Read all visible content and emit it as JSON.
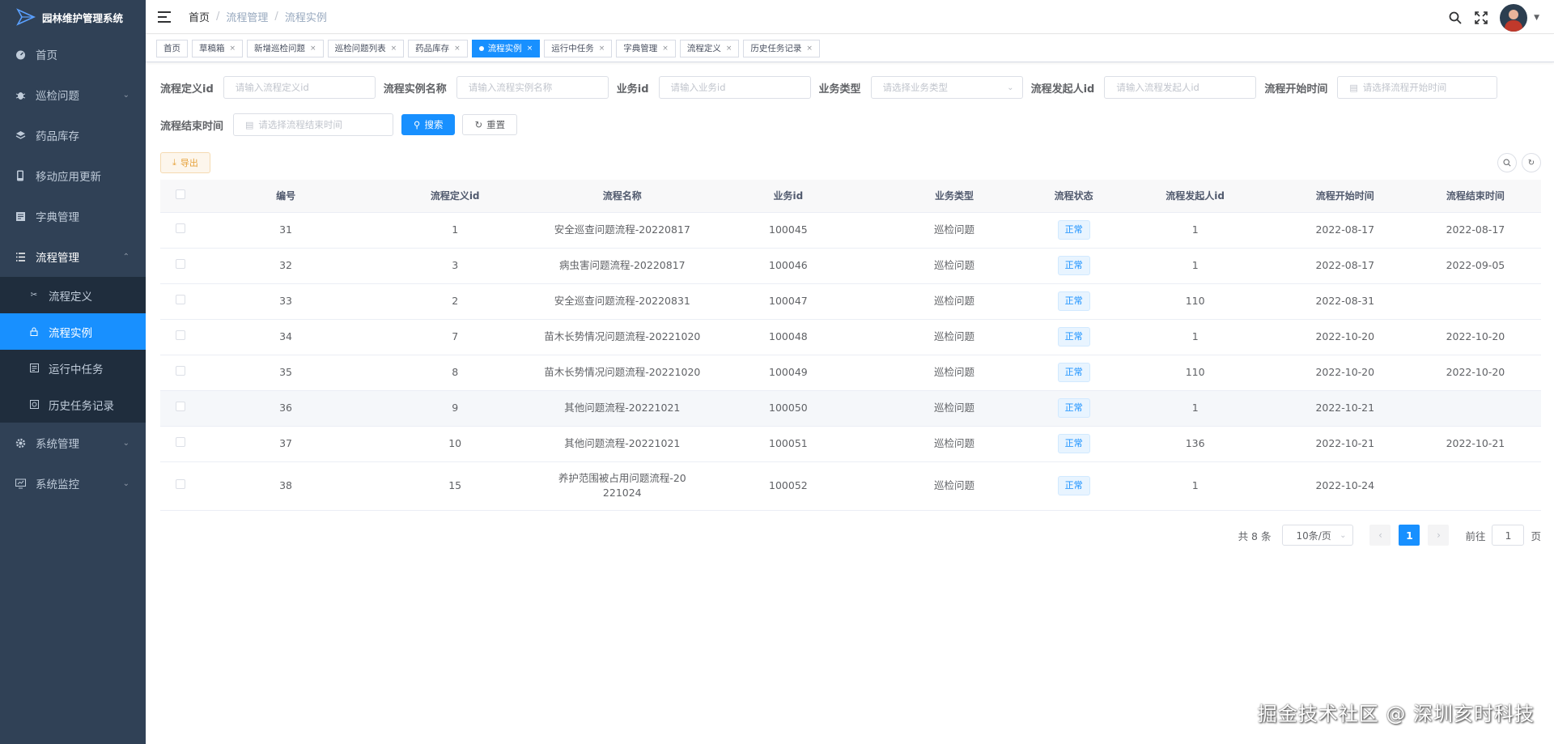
{
  "app": {
    "title": "园林维护管理系统"
  },
  "sidebar": {
    "items": [
      {
        "label": "首页",
        "icon": "dashboard-icon"
      },
      {
        "label": "巡检问题",
        "icon": "bug-icon",
        "has_children": true
      },
      {
        "label": "药品库存",
        "icon": "layers-icon"
      },
      {
        "label": "移动应用更新",
        "icon": "phone-icon"
      },
      {
        "label": "字典管理",
        "icon": "dict-icon"
      },
      {
        "label": "流程管理",
        "icon": "list-icon",
        "expanded": true
      },
      {
        "label": "系统管理",
        "icon": "gear-icon",
        "has_children": true
      },
      {
        "label": "系统监控",
        "icon": "monitor-icon",
        "has_children": true
      }
    ],
    "sub_items": [
      {
        "label": "流程定义",
        "icon": "tool-icon"
      },
      {
        "label": "流程实例",
        "icon": "lock-icon",
        "active": true
      },
      {
        "label": "运行中任务",
        "icon": "doc-icon"
      },
      {
        "label": "历史任务记录",
        "icon": "history-icon"
      }
    ]
  },
  "breadcrumb": [
    "首页",
    "流程管理",
    "流程实例"
  ],
  "tags": [
    {
      "label": "首页",
      "closable": false
    },
    {
      "label": "草稿箱",
      "closable": true
    },
    {
      "label": "新增巡检问题",
      "closable": true
    },
    {
      "label": "巡检问题列表",
      "closable": true
    },
    {
      "label": "药品库存",
      "closable": true
    },
    {
      "label": "流程实例",
      "closable": true,
      "active": true
    },
    {
      "label": "运行中任务",
      "closable": true
    },
    {
      "label": "字典管理",
      "closable": true
    },
    {
      "label": "流程定义",
      "closable": true
    },
    {
      "label": "历史任务记录",
      "closable": true
    }
  ],
  "search": {
    "def_id_label": "流程定义id",
    "def_id_placeholder": "请输入流程定义id",
    "inst_name_label": "流程实例名称",
    "inst_name_placeholder": "请输入流程实例名称",
    "biz_id_label": "业务id",
    "biz_id_placeholder": "请输入业务id",
    "biz_type_label": "业务类型",
    "biz_type_placeholder": "请选择业务类型",
    "initiator_label": "流程发起人id",
    "initiator_placeholder": "请输入流程发起人id",
    "start_label": "流程开始时间",
    "start_placeholder": "请选择流程开始时间",
    "end_label": "流程结束时间",
    "end_placeholder": "请选择流程结束时间",
    "search_btn": "搜索",
    "reset_btn": "重置"
  },
  "toolbar": {
    "export_label": "导出"
  },
  "table": {
    "columns": [
      "编号",
      "流程定义id",
      "流程名称",
      "业务id",
      "业务类型",
      "流程状态",
      "流程发起人id",
      "流程开始时间",
      "流程结束时间"
    ],
    "rows": [
      [
        "31",
        "1",
        "安全巡查问题流程-20220817",
        "100045",
        "巡检问题",
        "正常",
        "1",
        "2022-08-17",
        "2022-08-17"
      ],
      [
        "32",
        "3",
        "病虫害问题流程-20220817",
        "100046",
        "巡检问题",
        "正常",
        "1",
        "2022-08-17",
        "2022-09-05"
      ],
      [
        "33",
        "2",
        "安全巡查问题流程-20220831",
        "100047",
        "巡检问题",
        "正常",
        "110",
        "2022-08-31",
        ""
      ],
      [
        "34",
        "7",
        "苗木长势情况问题流程-20221020",
        "100048",
        "巡检问题",
        "正常",
        "1",
        "2022-10-20",
        "2022-10-20"
      ],
      [
        "35",
        "8",
        "苗木长势情况问题流程-20221020",
        "100049",
        "巡检问题",
        "正常",
        "110",
        "2022-10-20",
        "2022-10-20"
      ],
      [
        "36",
        "9",
        "其他问题流程-20221021",
        "100050",
        "巡检问题",
        "正常",
        "1",
        "2022-10-21",
        ""
      ],
      [
        "37",
        "10",
        "其他问题流程-20221021",
        "100051",
        "巡检问题",
        "正常",
        "136",
        "2022-10-21",
        "2022-10-21"
      ],
      [
        "38",
        "15",
        "养护范围被占用问题流程-20221024",
        "100052",
        "巡检问题",
        "正常",
        "1",
        "2022-10-24",
        ""
      ]
    ]
  },
  "pagination": {
    "total_text": "共 8 条",
    "page_size": "10条/页",
    "current_page": "1",
    "goto_label": "前往",
    "goto_value": "1",
    "page_unit": "页"
  },
  "watermark": "掘金技术社区 @ 深圳亥时科技",
  "colors": {
    "sidebar_bg": "#304156",
    "submenu_bg": "#1f2d3d",
    "accent": "#1890ff"
  }
}
